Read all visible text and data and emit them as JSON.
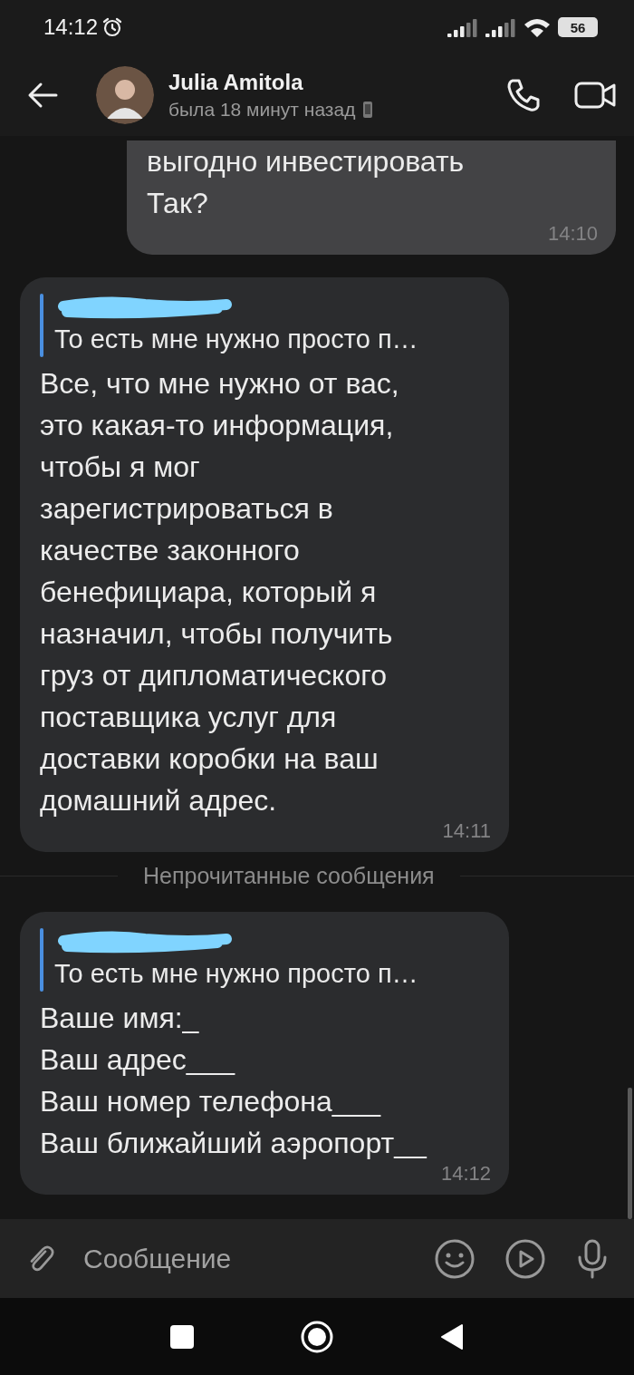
{
  "status_bar": {
    "time": "14:12",
    "battery": "56"
  },
  "header": {
    "name": "Julia Amitola",
    "last_seen": "была 18 минут назад"
  },
  "messages": [
    {
      "kind": "outgoing",
      "text": "выгодно инвестировать\nТак?",
      "time": "14:10"
    },
    {
      "kind": "incoming",
      "reply": {
        "text": "То есть мне нужно просто п…"
      },
      "text": "Все, что мне нужно от вас,\nэто какая-то информация,\nчтобы я мог\nзарегистрироваться в\nкачестве законного\nбенефициара, который я\nназначил, чтобы получить\nгруз от дипломатического\nпоставщика услуг для\nдоставки коробки на ваш\nдомашний адрес.",
      "time": "14:11"
    },
    {
      "kind": "divider",
      "text": "Непрочитанные сообщения"
    },
    {
      "kind": "incoming",
      "reply": {
        "text": "То есть мне нужно просто п…"
      },
      "text": "Ваше имя:_\nВаш адрес___\nВаш номер телефона___\nВаш ближайший аэропорт__",
      "time": "14:12"
    }
  ],
  "composer": {
    "placeholder": "Сообщение"
  }
}
